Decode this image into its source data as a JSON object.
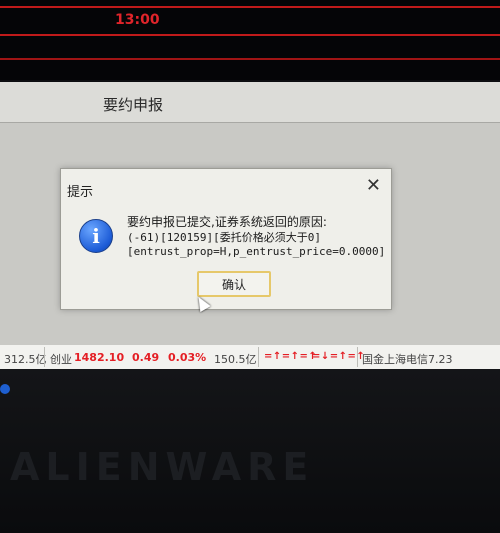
{
  "chart": {
    "time_label": "13:00"
  },
  "window": {
    "title": "要约申报"
  },
  "dialog": {
    "caption": "提示",
    "close_glyph": "✕",
    "icon": "info-icon",
    "line1": "要约申报已提交,证券系统返回的原因:",
    "line2": "(-61)[120159][委托价格必须大于0]",
    "line3": "[entrust_prop=H,p_entrust_price=0.0000]",
    "ok_label": "确认"
  },
  "statusbar": {
    "amount1": "312.5亿",
    "index_name": "创业",
    "index_value": "1482.10",
    "index_change": "0.49",
    "index_pct": "0.03%",
    "amount2": "150.5亿",
    "indicator1": "=↑=↑=↑",
    "indicator2": "=↓=↑=↑",
    "ticker": "国金上海电信7.23"
  },
  "laptop": {
    "brand": "ALIENWARE"
  },
  "colors": {
    "accent_red": "#e41e24",
    "dialog_bg": "#efefea",
    "button_border": "#e6c86a"
  }
}
